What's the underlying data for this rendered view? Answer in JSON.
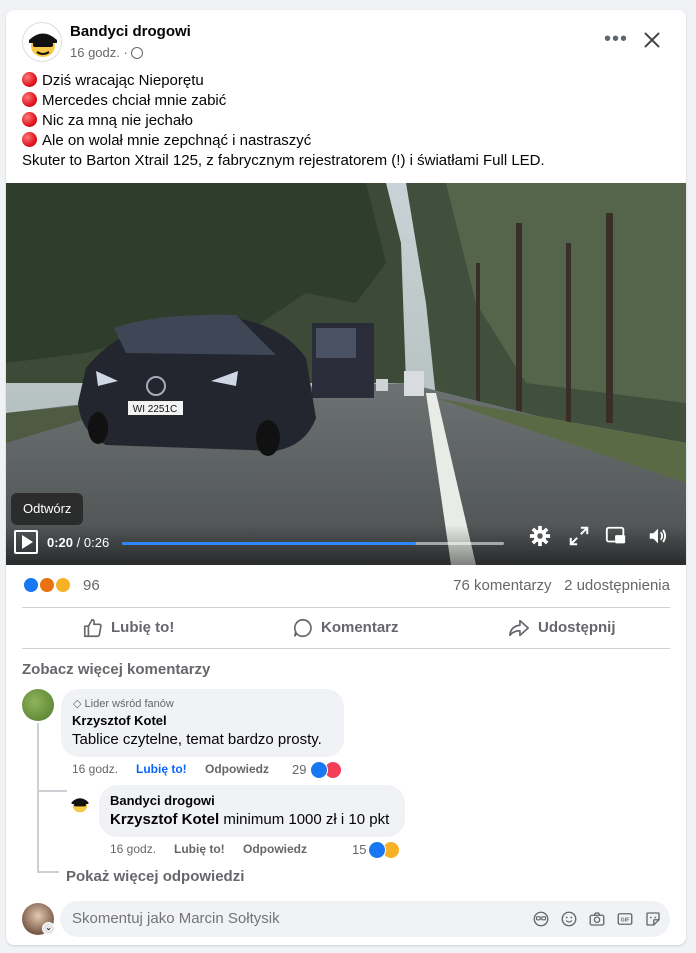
{
  "post": {
    "page_name": "Bandyci drogowi",
    "time": "16 godz. ·",
    "lines": [
      "Dziś wracając Nieporętu",
      "Mercedes chciał mnie zabić",
      "Nic za mną nie jechało",
      "Ale on wolał mnie zepchnąć i nastraszyć"
    ],
    "last_line": "Skuter to Barton Xtrail 125, z fabrycznym rejestratorem (!) i światłami Full LED.",
    "more_icon": "more-horizontal-icon",
    "close_icon": "close-icon"
  },
  "video": {
    "tooltip": "Odtwórz",
    "current_time": "0:20",
    "duration": "/ 0:26",
    "progress": 0.77,
    "plate": "WI 2251C"
  },
  "stats": {
    "reactions_count": "96",
    "comments": "76 komentarzy",
    "shares": "2 udostępnienia"
  },
  "actions": {
    "like": "Lubię to!",
    "comment": "Komentarz",
    "share": "Udostępnij"
  },
  "comments": {
    "see_more": "Zobacz więcej komentarzy",
    "first": {
      "badge": "Lider wśród fanów",
      "author": "Krzysztof Kotel",
      "text": "Tablice czytelne, temat bardzo prosty.",
      "time": "16 godz.",
      "like": "Lubię to!",
      "reply": "Odpowiedz",
      "reactions": "29"
    },
    "reply": {
      "author": "Bandyci drogowi",
      "mention": "Krzysztof Kotel",
      "text": "minimum 1000 zł i 10 pkt",
      "time": "16 godz.",
      "like": "Lubię to!",
      "reply": "Odpowiedz",
      "reactions": "15"
    },
    "show_more_replies": "Pokaż więcej odpowiedzi"
  },
  "composer": {
    "placeholder": "Skomentuj jako Marcin Sołtysik"
  },
  "colors": {
    "accent": "#0866ff",
    "like": "#1877f2",
    "love": "#f33e58",
    "haha": "#f7b125",
    "angry": "#e9710f"
  }
}
